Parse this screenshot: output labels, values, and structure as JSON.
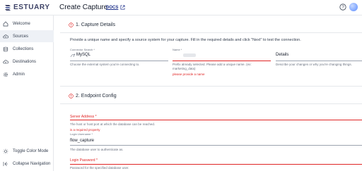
{
  "header": {
    "logo_text": "ESTUARY",
    "title": "Create Capture",
    "docs_label": "DOCS"
  },
  "sidebar": {
    "items": [
      {
        "label": "Welcome",
        "icon": "home-icon"
      },
      {
        "label": "Sources",
        "icon": "cloud-upload-icon",
        "active": true
      },
      {
        "label": "Collections",
        "icon": "database-icon"
      },
      {
        "label": "Destinations",
        "icon": "cloud-download-icon"
      },
      {
        "label": "Admin",
        "icon": "gear-icon"
      }
    ],
    "bottom": [
      {
        "label": "Toggle Color Mode",
        "icon": "sun-icon"
      },
      {
        "label": "Collapse Navigation",
        "icon": "collapse-icon"
      }
    ]
  },
  "capture_details": {
    "title": "1. Capture Details",
    "intro": "Provide a unique name and specify a source system for your capture. Fill in the required details and click \"Next\" to test the connection.",
    "connector": {
      "label": "Connector Search *",
      "value": "MySQL",
      "helper": "Choose the external system you're connecting to."
    },
    "name": {
      "label": "Name *",
      "helper": "Prefix already selected. Please add a unique name. (ex: marketing_data)",
      "error": "please provide a name"
    },
    "details": {
      "label": "Details",
      "helper": "Describe your changes or why you're changing things."
    }
  },
  "endpoint_config": {
    "title": "2. Endpoint Config",
    "server_address": {
      "label": "Server Address *",
      "helper": "The host or host:port at which the database can be reached.",
      "error": "is a required property"
    },
    "login_username": {
      "label": "Login Username *",
      "value": "flow_capture",
      "helper": "The database user to authenticate as."
    },
    "login_password": {
      "label": "Login Password *",
      "helper": "Password for the specified database user."
    }
  },
  "colors": {
    "accent": "#1c2f8a",
    "error": "#e02424",
    "active_bg": "#eef1f6"
  }
}
